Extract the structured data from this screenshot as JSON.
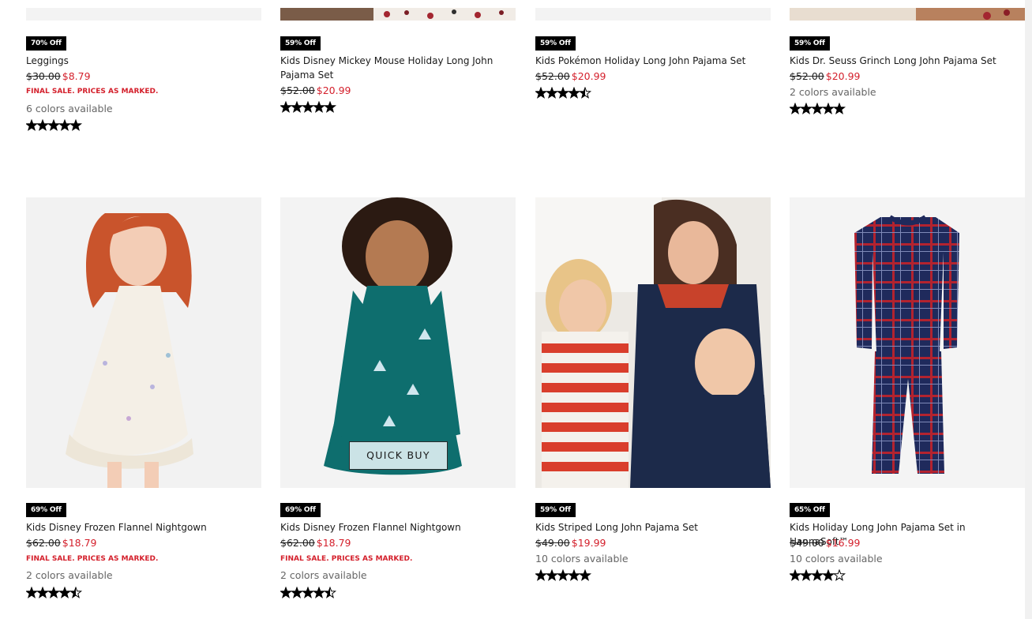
{
  "colors": {
    "sale": "#d4202c",
    "badge_bg": "#000000",
    "badge_text": "#ffffff"
  },
  "quick_buy_label": "QUICK BUY",
  "products": [
    {
      "image": "product-photo-leggings",
      "badge": "70% Off",
      "name": "Leggings",
      "was": "$30.00",
      "now": "$8.79",
      "final": "FINAL SALE. PRICES AS MARKED.",
      "colors_text": "6 colors available",
      "rating": 5
    },
    {
      "image": "product-photo-mickey-pajamas",
      "badge": "59% Off",
      "name": "Kids Disney Mickey Mouse Holiday Long John Pajama Set",
      "was": "$52.00",
      "now": "$20.99",
      "final": "",
      "colors_text": "",
      "rating": 5
    },
    {
      "image": "product-photo-pokemon-pajamas",
      "badge": "59% Off",
      "name": "Kids Pokémon Holiday Long John Pajama Set",
      "was": "$52.00",
      "now": "$20.99",
      "final": "",
      "colors_text": "",
      "rating": 4.5
    },
    {
      "image": "product-photo-grinch-pajamas",
      "badge": "59% Off",
      "name": "Kids Dr. Seuss Grinch Long John Pajama Set",
      "was": "$52.00",
      "now": "$20.99",
      "final": "",
      "colors_text": "2 colors available",
      "rating": 5
    },
    {
      "image": "product-photo-frozen-nightgown-white",
      "badge": "69% Off",
      "name": "Kids Disney Frozen Flannel Nightgown",
      "was": "$62.00",
      "now": "$18.79",
      "final": "FINAL SALE. PRICES AS MARKED.",
      "colors_text": "2 colors available",
      "rating": 4.5
    },
    {
      "image": "product-photo-frozen-nightgown-teal",
      "badge": "69% Off",
      "name": "Kids Disney Frozen Flannel Nightgown",
      "was": "$62.00",
      "now": "$18.79",
      "final": "FINAL SALE. PRICES AS MARKED.",
      "colors_text": "2 colors available",
      "rating": 4.5
    },
    {
      "image": "product-photo-striped-pajamas",
      "badge": "59% Off",
      "name": "Kids Striped Long John Pajama Set",
      "was": "$49.00",
      "now": "$19.99",
      "final": "",
      "colors_text": "10 colors available",
      "rating": 5
    },
    {
      "image": "product-photo-plaid-pajamas",
      "badge": "65% Off",
      "name": "Kids Holiday Long John Pajama Set in HannaSoft™",
      "was": "$49.00",
      "now": "$16.99",
      "final": "",
      "colors_text": "10 colors available",
      "rating": 4
    }
  ]
}
